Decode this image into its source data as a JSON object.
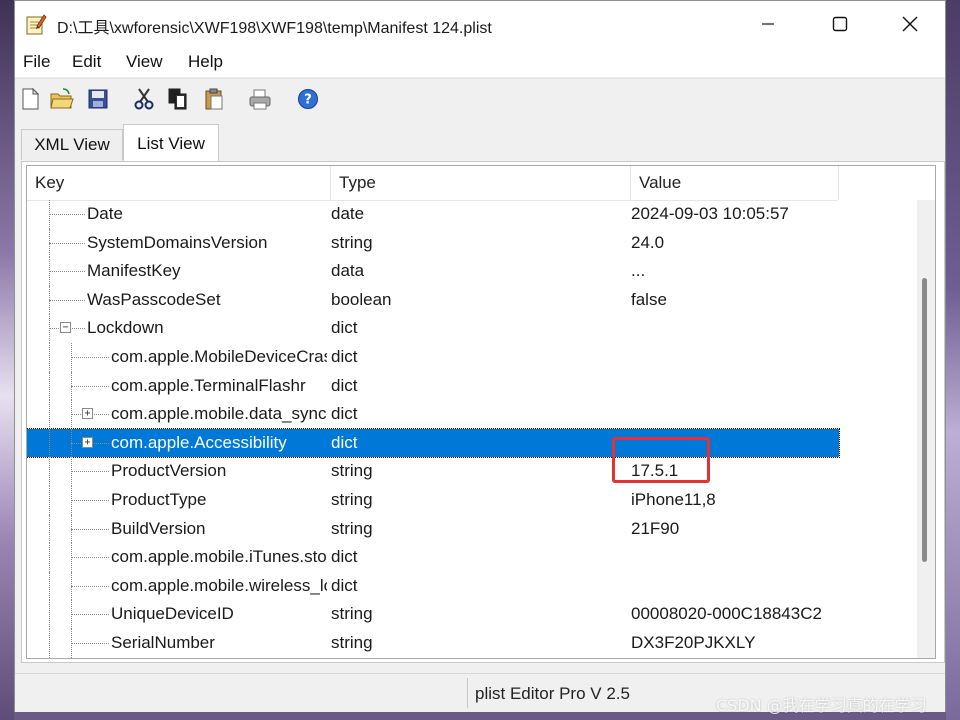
{
  "window": {
    "title": "D:\\工具\\xwforensic\\XWF198\\XWF198\\temp\\Manifest 124.plist",
    "icons": {
      "app": "notepad-edit-icon",
      "minimize": "minimize-icon",
      "maximize": "maximize-icon",
      "close": "close-icon"
    }
  },
  "menu": [
    {
      "label": "File"
    },
    {
      "label": "Edit"
    },
    {
      "label": "View"
    },
    {
      "label": "Help"
    }
  ],
  "toolbar": [
    {
      "icon": "new-file-icon"
    },
    {
      "icon": "open-folder-icon"
    },
    {
      "icon": "save-icon"
    },
    {
      "icon": "cut-icon"
    },
    {
      "icon": "copy-icon"
    },
    {
      "icon": "paste-icon"
    },
    {
      "icon": "print-icon"
    },
    {
      "icon": "help-icon"
    }
  ],
  "tabs": [
    {
      "label": "XML View",
      "active": false
    },
    {
      "label": "List View",
      "active": true
    }
  ],
  "list": {
    "columns": [
      "Key",
      "Type",
      "Value"
    ],
    "rows": [
      {
        "key": "Date",
        "type": "date",
        "value": "2024-09-03 10:05:57",
        "depth": 1,
        "expander": ""
      },
      {
        "key": "SystemDomainsVersion",
        "type": "string",
        "value": "24.0",
        "depth": 1,
        "expander": ""
      },
      {
        "key": "ManifestKey",
        "type": "data",
        "value": "...",
        "depth": 1,
        "expander": ""
      },
      {
        "key": "WasPasscodeSet",
        "type": "boolean",
        "value": "false",
        "depth": 1,
        "expander": ""
      },
      {
        "key": "Lockdown",
        "type": "dict",
        "value": "",
        "depth": 1,
        "expander": "−"
      },
      {
        "key": "com.apple.MobileDeviceCrashCopy",
        "type": "dict",
        "value": "",
        "depth": 2,
        "expander": ""
      },
      {
        "key": "com.apple.TerminalFlashr",
        "type": "dict",
        "value": "",
        "depth": 2,
        "expander": ""
      },
      {
        "key": "com.apple.mobile.data_sync",
        "type": "dict",
        "value": "",
        "depth": 2,
        "expander": "+"
      },
      {
        "key": "com.apple.Accessibility",
        "type": "dict",
        "value": "",
        "depth": 2,
        "expander": "+",
        "selected": true
      },
      {
        "key": "ProductVersion",
        "type": "string",
        "value": "17.5.1",
        "depth": 2,
        "expander": ""
      },
      {
        "key": "ProductType",
        "type": "string",
        "value": "iPhone11,8",
        "depth": 2,
        "expander": ""
      },
      {
        "key": "BuildVersion",
        "type": "string",
        "value": "21F90",
        "depth": 2,
        "expander": ""
      },
      {
        "key": "com.apple.mobile.iTunes.store",
        "type": "dict",
        "value": "",
        "depth": 2,
        "expander": ""
      },
      {
        "key": "com.apple.mobile.wireless_lockdown",
        "type": "dict",
        "value": "",
        "depth": 2,
        "expander": ""
      },
      {
        "key": "UniqueDeviceID",
        "type": "string",
        "value": "00008020-000C18843C2",
        "depth": 2,
        "expander": ""
      },
      {
        "key": "SerialNumber",
        "type": "string",
        "value": "DX3F20PJKXLY",
        "depth": 2,
        "expander": ""
      }
    ]
  },
  "status": {
    "text": "plist Editor Pro V 2.5"
  },
  "annotation": {
    "color": "#e53131"
  },
  "watermark": "CSDN @我在学习真的在学习",
  "colors": {
    "selection": "#0078d7",
    "highlight": "#e53131"
  }
}
